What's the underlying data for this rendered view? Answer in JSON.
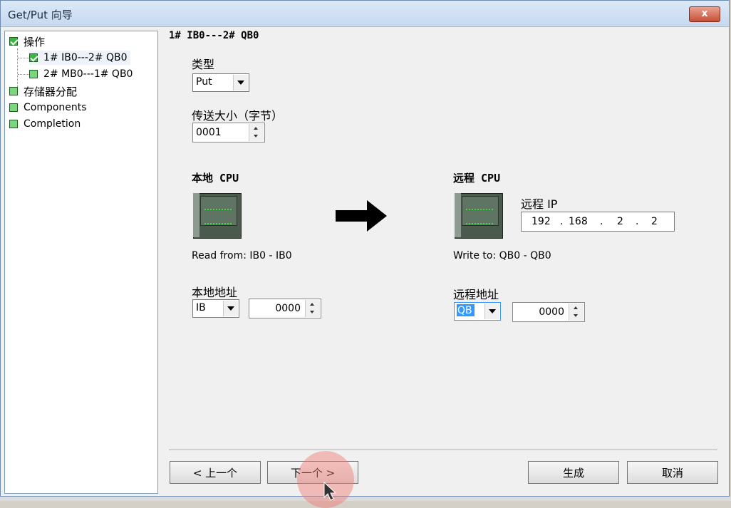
{
  "window": {
    "title": "Get/Put 向导",
    "close_glyph": "x"
  },
  "tree": {
    "items": [
      {
        "label": "操作",
        "checked": true
      },
      {
        "label": "1# IB0---2# QB0",
        "checked": true,
        "selected": true
      },
      {
        "label": "2# MB0---1# QB0",
        "checked": false
      },
      {
        "label": "存储器分配",
        "checked": false
      },
      {
        "label": "Components",
        "checked": false
      },
      {
        "label": "Completion",
        "checked": false
      }
    ]
  },
  "main": {
    "header": "1# IB0---2# QB0",
    "type_label": "类型",
    "type_value": "Put",
    "size_label": "传送大小（字节）",
    "size_value": "0001",
    "local": {
      "title": "本地 CPU",
      "read_text": "Read from: IB0 - IB0",
      "addr_label": "本地地址",
      "area": "IB",
      "offset": "0000"
    },
    "remote": {
      "title": "远程 CPU",
      "ip_label": "远程 IP",
      "ip": [
        "192",
        ".",
        "168",
        ".",
        "2",
        ".",
        "2"
      ],
      "write_text": "Write to: QB0 - QB0",
      "addr_label": "远程地址",
      "area": "QB",
      "offset": "0000"
    }
  },
  "buttons": {
    "prev": "< 上一个",
    "next": "下一个 >",
    "generate": "生成",
    "cancel": "取消"
  },
  "colors": {
    "accent_highlight": "#3399ff",
    "check_green": "#3bb542"
  }
}
